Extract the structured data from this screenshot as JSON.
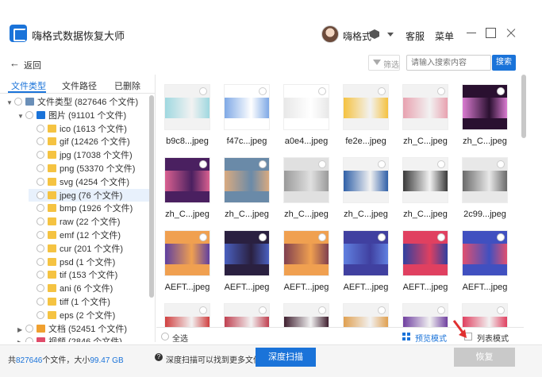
{
  "app": {
    "title": "嗨格式数据恢复大师",
    "username": "嗨格式"
  },
  "header": {
    "service": "客服",
    "menu": "菜单"
  },
  "toolbar": {
    "back": "返回",
    "filter": "筛选",
    "search_placeholder": "请输入搜索内容",
    "search_button": "搜索"
  },
  "tabs": [
    "文件类型",
    "文件路径",
    "已删除"
  ],
  "tree": [
    {
      "label": "文件类型 (827646 个文件)",
      "icon": "disk-icon",
      "depth": 0,
      "caret": "▼"
    },
    {
      "label": "图片 (91101 个文件)",
      "icon": "image-icon",
      "depth": 1,
      "caret": "▼"
    },
    {
      "label": "ico (1613 个文件)",
      "icon": "folder-icon",
      "depth": 2,
      "caret": ""
    },
    {
      "label": "gif (12426 个文件)",
      "icon": "folder-icon",
      "depth": 2,
      "caret": ""
    },
    {
      "label": "jpg (17038 个文件)",
      "icon": "folder-icon",
      "depth": 2,
      "caret": ""
    },
    {
      "label": "png (53370 个文件)",
      "icon": "folder-icon",
      "depth": 2,
      "caret": ""
    },
    {
      "label": "svg (4254 个文件)",
      "icon": "folder-icon",
      "depth": 2,
      "caret": ""
    },
    {
      "label": "jpeg (76 个文件)",
      "icon": "folder-icon",
      "depth": 2,
      "caret": "",
      "selected": true
    },
    {
      "label": "bmp (1926 个文件)",
      "icon": "folder-icon",
      "depth": 2,
      "caret": ""
    },
    {
      "label": "raw (22 个文件)",
      "icon": "folder-icon",
      "depth": 2,
      "caret": ""
    },
    {
      "label": "emf (12 个文件)",
      "icon": "folder-icon",
      "depth": 2,
      "caret": ""
    },
    {
      "label": "cur (201 个文件)",
      "icon": "folder-icon",
      "depth": 2,
      "caret": ""
    },
    {
      "label": "psd (1 个文件)",
      "icon": "folder-icon",
      "depth": 2,
      "caret": ""
    },
    {
      "label": "tif (153 个文件)",
      "icon": "folder-icon",
      "depth": 2,
      "caret": ""
    },
    {
      "label": "ani (6 个文件)",
      "icon": "folder-icon",
      "depth": 2,
      "caret": ""
    },
    {
      "label": "tiff (1 个文件)",
      "icon": "folder-icon",
      "depth": 2,
      "caret": ""
    },
    {
      "label": "eps (2 个文件)",
      "icon": "folder-icon",
      "depth": 2,
      "caret": ""
    },
    {
      "label": "文档 (52451 个文件)",
      "icon": "document-icon",
      "depth": 1,
      "caret": "▶"
    },
    {
      "label": "视频 (2846 个文件)",
      "icon": "video-icon",
      "depth": 1,
      "caret": "▶"
    }
  ],
  "files": [
    {
      "name": "b9c8...jpeg",
      "thumb": [
        "#f2f2f2",
        "#9fd8e0"
      ]
    },
    {
      "name": "f47c...jpeg",
      "thumb": [
        "#ffffff",
        "#7fa9e6"
      ]
    },
    {
      "name": "a0e4...jpeg",
      "thumb": [
        "#ffffff",
        "#e8e8e8"
      ]
    },
    {
      "name": "fe2e...jpeg",
      "thumb": [
        "#f2f2f2",
        "#f5c240"
      ]
    },
    {
      "name": "zh_C...jpeg",
      "thumb": [
        "#f2f2f2",
        "#e8a2b0"
      ]
    },
    {
      "name": "zh_C...jpeg",
      "thumb": [
        "#2a1030",
        "#d97bd0"
      ]
    },
    {
      "name": "zh_C...jpeg",
      "thumb": [
        "#4a2060",
        "#d96090"
      ]
    },
    {
      "name": "zh_C...jpeg",
      "thumb": [
        "#6a8aa8",
        "#d9aa80"
      ]
    },
    {
      "name": "zh_C...jpeg",
      "thumb": [
        "#e0e0e0",
        "#9a9a9a"
      ]
    },
    {
      "name": "zh_C...jpeg",
      "thumb": [
        "#f2f2f2",
        "#3060a8"
      ]
    },
    {
      "name": "zh_C...jpeg",
      "thumb": [
        "#f2f2f2",
        "#3a3a3a"
      ]
    },
    {
      "name": "2c99...jpeg",
      "thumb": [
        "#e8e8e8",
        "#6a6a6a"
      ]
    },
    {
      "name": "AEFT...jpeg",
      "thumb": [
        "#f0a050",
        "#6040a0"
      ]
    },
    {
      "name": "AEFT...jpeg",
      "thumb": [
        "#2a2040",
        "#4a60c0"
      ]
    },
    {
      "name": "AEFT...jpeg",
      "thumb": [
        "#f0a050",
        "#804050"
      ]
    },
    {
      "name": "AEFT...jpeg",
      "thumb": [
        "#4040a0",
        "#6080e0"
      ]
    },
    {
      "name": "AEFT...jpeg",
      "thumb": [
        "#e04060",
        "#3040a0"
      ]
    },
    {
      "name": "AEFT...jpeg",
      "thumb": [
        "#4050c0",
        "#e05070"
      ]
    },
    {
      "name": "",
      "thumb": [
        "#f2f2f2",
        "#d04040"
      ]
    },
    {
      "name": "",
      "thumb": [
        "#f2f2f2",
        "#c04050"
      ]
    },
    {
      "name": "",
      "thumb": [
        "#f2f2f2",
        "#402030"
      ]
    },
    {
      "name": "",
      "thumb": [
        "#f2f2f2",
        "#e0a050"
      ]
    },
    {
      "name": "",
      "thumb": [
        "#f2f2f2",
        "#7040a0"
      ]
    },
    {
      "name": "",
      "thumb": [
        "#f2f2f2",
        "#e04060"
      ]
    }
  ],
  "footer": {
    "select_all": "全选",
    "preview_mode": "预览模式",
    "list_mode": "列表模式"
  },
  "status": {
    "prefix": "共",
    "count": "827646",
    "mid": "个文件，大小",
    "size": "99.47 GB",
    "hint": "深度扫描可以找到更多文件",
    "deep_scan": "深度扫描",
    "recover": "恢复"
  },
  "colors": {
    "accent": "#1a73d9",
    "recover_disabled": "#c9c9c9"
  }
}
